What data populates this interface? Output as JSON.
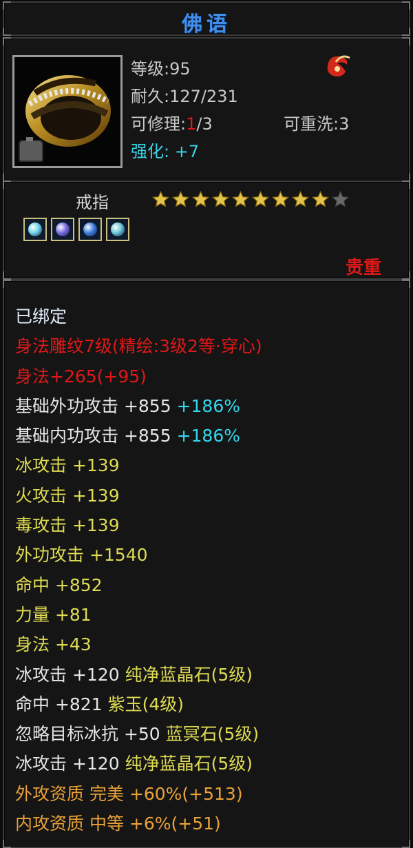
{
  "title": "佛语",
  "item": {
    "level": "等级:95",
    "durability": "耐久:127/231",
    "repair_prefix": "可修理:",
    "repair_current": "1",
    "repair_suffix": "/3",
    "rewash": "可重洗:3",
    "enhance": "强化:  +7",
    "type": "戒指",
    "stars_total": 10,
    "stars_filled": 9,
    "quality": "贵重",
    "colors": {
      "title": "#3f8ff0",
      "red": "#e01818",
      "yellow": "#dedb53",
      "cyan": "#33d7ec",
      "orange": "#e9a23a",
      "star": "#e3c34a"
    }
  },
  "gems": [
    {
      "name": "gem-cyan",
      "color": "#6fd6e8"
    },
    {
      "name": "gem-purple",
      "color": "#7a6be4"
    },
    {
      "name": "gem-blue",
      "color": "#3e7fe0"
    },
    {
      "name": "gem-teal",
      "color": "#6ac6d8"
    }
  ],
  "bound": "已绑定",
  "attrs": {
    "carve": "身法雕纹7级(精绘:3级2等·穿心)",
    "agility_main": "身法+265(+95)",
    "ext_base_a": "基础外功攻击  +855",
    "ext_base_b": " +186%",
    "int_base_a": "基础内功攻击  +855",
    "int_base_b": " +186%",
    "ice": "冰攻击  +139",
    "fire": "火攻击  +139",
    "poison": "毒攻击  +139",
    "external": "外功攻击  +1540",
    "hit": "命中  +852",
    "strength": "力量  +81",
    "agility": "身法  +43",
    "gem1_a": "冰攻击  +120  ",
    "gem1_b": "纯净蓝晶石(5级)",
    "gem2_a": "命中  +821  ",
    "gem2_b": "紫玉(4级)",
    "gem3_a": "忽略目标冰抗  +50  ",
    "gem3_b": "蓝冥石(5级)",
    "gem4_a": "冰攻击  +120  ",
    "gem4_b": "纯净蓝晶石(5级)",
    "apt_ext": "外攻资质   完美  +60%(+513)",
    "apt_int": "内攻资质   中等  +6%(+51)"
  }
}
